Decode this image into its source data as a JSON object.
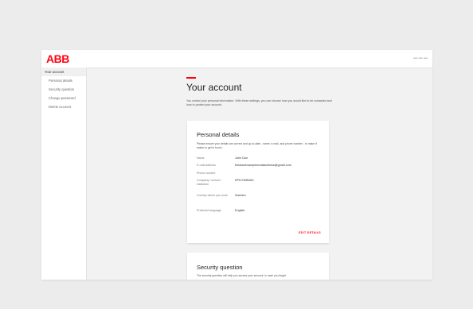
{
  "header": {
    "logo": "ABB"
  },
  "sidebar": {
    "items": [
      {
        "label": "Your account"
      },
      {
        "label": "Personal details"
      },
      {
        "label": "Security question"
      },
      {
        "label": "Change password"
      },
      {
        "label": "Delete account"
      }
    ]
  },
  "main": {
    "title": "Your account",
    "intro": "You control your personal information. With these settings, you can choose how you would like to be contacted and how to protect your account."
  },
  "personal_details": {
    "title": "Personal details",
    "description": "Please ensure your details are correct and up-to-date - name, e-mail, and phone number - to make it easier to get in touch.",
    "rows": [
      {
        "label": "Name",
        "value": "John Doe"
      },
      {
        "label": "E-mail address",
        "value": "thisisanexampleemailaddress@gmail.com"
      },
      {
        "label": "Phone number",
        "value": ""
      },
      {
        "label": "Company / school / institution",
        "value": "EPICOMINAX"
      },
      {
        "label": "Country where you work",
        "value": "Sweden"
      },
      {
        "label": "Preferred language",
        "value": "English"
      }
    ],
    "edit_label": "EDIT DETAILS"
  },
  "security_question": {
    "title": "Security question",
    "description": "The security question will help you access your account, in case you forget"
  },
  "colors": {
    "brand_red": "#ff000f"
  }
}
